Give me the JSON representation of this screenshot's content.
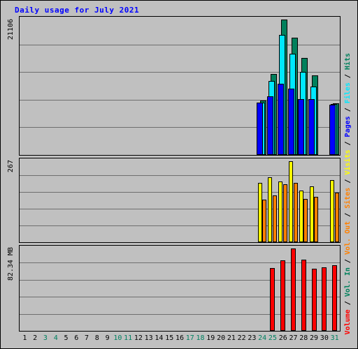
{
  "title": "Daily usage for July 2021",
  "axes": {
    "y_hits_label": "21106",
    "y_visits_label": "267",
    "y_volume_label": "82.34 MB",
    "x_days": [
      "1",
      "2",
      "3",
      "4",
      "5",
      "6",
      "7",
      "8",
      "9",
      "10",
      "11",
      "12",
      "13",
      "14",
      "15",
      "16",
      "17",
      "18",
      "19",
      "20",
      "21",
      "22",
      "23",
      "24",
      "25",
      "26",
      "27",
      "28",
      "29",
      "30",
      "31"
    ],
    "weekend_days": [
      "3",
      "4",
      "10",
      "11",
      "17",
      "18",
      "24",
      "25",
      "31"
    ]
  },
  "legend": {
    "separator": " / ",
    "entries": [
      {
        "label": "Volume",
        "color": "#ff0000"
      },
      {
        "label": "Vol. In",
        "color": "#00805c"
      },
      {
        "label": "Vol. Out",
        "color": "#ff8000"
      },
      {
        "label": "Sites",
        "color": "#ff8000"
      },
      {
        "label": "Visits",
        "color": "#ffff00"
      },
      {
        "label": "Pages",
        "color": "#0000ff"
      },
      {
        "label": "Files",
        "color": "#00e8ff"
      },
      {
        "label": "Hits",
        "color": "#00805c"
      }
    ]
  },
  "colors": {
    "background": "#c0c0c0",
    "title": "#0000ff",
    "gridline": "#6f6f6f",
    "border": "#000000",
    "hits": "#00805c",
    "files": "#00e8ff",
    "pages": "#0000ff",
    "visits": "#ffff00",
    "sites": "#ff8000",
    "volume": "#ff0000",
    "weekday_tick": "#000000",
    "weekend_tick": "#008060"
  },
  "chart_data": {
    "type": "bar",
    "title": "Daily usage for July 2021",
    "xlabel": "",
    "ylabel": "Volume / Vol. In / Vol. Out / Sites / Visits / Pages / Files / Hits",
    "grid": true,
    "legend_position": "right-vertical",
    "panels": [
      {
        "name": "hits-files-pages",
        "ylabel": "21106",
        "ymax": 21106,
        "gridlines": 4,
        "categories": [
          "1",
          "2",
          "3",
          "4",
          "5",
          "6",
          "7",
          "8",
          "9",
          "10",
          "11",
          "12",
          "13",
          "14",
          "15",
          "16",
          "17",
          "18",
          "19",
          "20",
          "21",
          "22",
          "23",
          "24",
          "25",
          "26",
          "27",
          "28",
          "29",
          "30",
          "31"
        ],
        "series": [
          {
            "name": "Hits",
            "color": "#00805c",
            "values": [
              0,
              0,
              0,
              0,
              0,
              0,
              0,
              0,
              0,
              0,
              0,
              0,
              0,
              0,
              0,
              0,
              0,
              0,
              0,
              0,
              0,
              0,
              0,
              8450,
              12600,
              21106,
              18300,
              15100,
              12400,
              0,
              8100
            ]
          },
          {
            "name": "Files",
            "color": "#00e8ff",
            "values": [
              0,
              0,
              0,
              0,
              0,
              0,
              0,
              0,
              0,
              0,
              0,
              0,
              0,
              0,
              0,
              0,
              0,
              0,
              0,
              0,
              0,
              0,
              0,
              8200,
              11500,
              18700,
              15800,
              13000,
              10700,
              0,
              7950
            ]
          },
          {
            "name": "Pages",
            "color": "#0000ff",
            "values": [
              0,
              0,
              0,
              0,
              0,
              0,
              0,
              0,
              0,
              0,
              0,
              0,
              0,
              0,
              0,
              0,
              0,
              0,
              0,
              0,
              0,
              0,
              0,
              8150,
              9100,
              11050,
              10300,
              8750,
              8700,
              0,
              7800
            ]
          }
        ]
      },
      {
        "name": "visits-sites",
        "ylabel": "267",
        "ymax": 267,
        "gridlines": 4,
        "categories": [
          "1",
          "2",
          "3",
          "4",
          "5",
          "6",
          "7",
          "8",
          "9",
          "10",
          "11",
          "12",
          "13",
          "14",
          "15",
          "16",
          "17",
          "18",
          "19",
          "20",
          "21",
          "22",
          "23",
          "24",
          "25",
          "26",
          "27",
          "28",
          "29",
          "30",
          "31"
        ],
        "series": [
          {
            "name": "Visits",
            "color": "#ffff00",
            "values": [
              0,
              0,
              0,
              0,
              0,
              0,
              0,
              0,
              0,
              0,
              0,
              0,
              0,
              0,
              0,
              0,
              0,
              0,
              0,
              0,
              0,
              0,
              0,
              196,
              213,
              201,
              267,
              170,
              185,
              0,
              205
            ]
          },
          {
            "name": "Sites",
            "color": "#ff8000",
            "values": [
              0,
              0,
              0,
              0,
              0,
              0,
              0,
              0,
              0,
              0,
              0,
              0,
              0,
              0,
              0,
              0,
              0,
              0,
              0,
              0,
              0,
              0,
              0,
              140,
              155,
              190,
              196,
              142,
              150,
              0,
              163
            ]
          }
        ]
      },
      {
        "name": "volume",
        "ylabel": "82.34 MB",
        "ymax": 82.34,
        "unit": "MB",
        "gridlines": 4,
        "categories": [
          "1",
          "2",
          "3",
          "4",
          "5",
          "6",
          "7",
          "8",
          "9",
          "10",
          "11",
          "12",
          "13",
          "14",
          "15",
          "16",
          "17",
          "18",
          "19",
          "20",
          "21",
          "22",
          "23",
          "24",
          "25",
          "26",
          "27",
          "28",
          "29",
          "30",
          "31"
        ],
        "series": [
          {
            "name": "Volume",
            "color": "#ff0000",
            "values": [
              0,
              0,
              0,
              0,
              0,
              0,
              0,
              0,
              0,
              0,
              0,
              0,
              0,
              0,
              0,
              0,
              0,
              0,
              0,
              0,
              0,
              0,
              0,
              0,
              62.5,
              70.5,
              82.34,
              71.5,
              62.0,
              63.5,
              65.5
            ]
          }
        ]
      }
    ]
  }
}
